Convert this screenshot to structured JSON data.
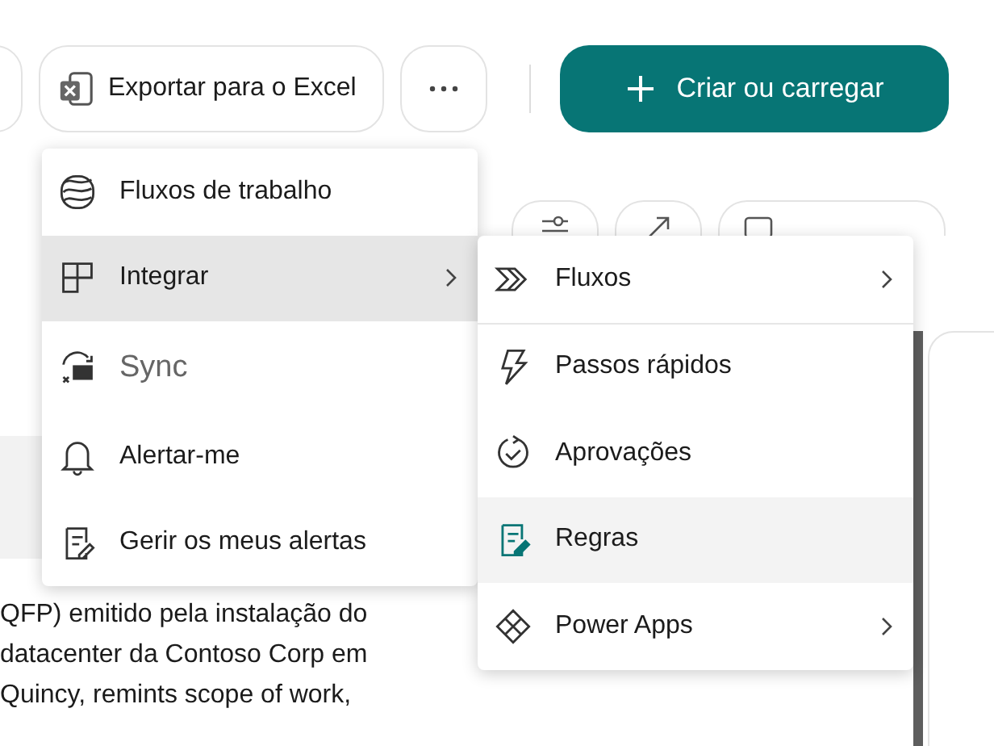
{
  "toolbar": {
    "export_button": "Exportar para o Excel",
    "create_button": "Criar ou carregar"
  },
  "menu": {
    "items": [
      {
        "label": "Fluxos de trabalho",
        "selected": false,
        "disabled": false,
        "submenu": false
      },
      {
        "label": "Integrar",
        "selected": true,
        "disabled": false,
        "submenu": true
      },
      {
        "label": "Sync",
        "selected": false,
        "disabled": true,
        "submenu": false
      },
      {
        "label": "Alertar-me",
        "selected": false,
        "disabled": false,
        "submenu": false
      },
      {
        "label": "Gerir os meus alertas",
        "selected": false,
        "disabled": false,
        "submenu": false
      }
    ]
  },
  "submenu": {
    "items": [
      {
        "label": "Fluxos",
        "selected": false,
        "submenu": true
      },
      {
        "label": "Passos rápidos",
        "selected": false,
        "submenu": false
      },
      {
        "label": "Aprovações",
        "selected": false,
        "submenu": false
      },
      {
        "label": "Regras",
        "selected": true,
        "submenu": false
      },
      {
        "label": "Power Apps",
        "selected": false,
        "submenu": true
      }
    ]
  },
  "description_lines": [
    "QFP) emitido pela instalação do",
    "datacenter da Contoso Corp em",
    "Quincy, remints scope of work,"
  ]
}
